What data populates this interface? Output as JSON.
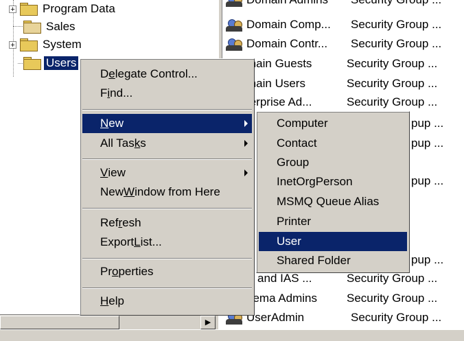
{
  "tree": {
    "items": [
      {
        "label": "Program Data",
        "expander": "+"
      },
      {
        "label": "Sales",
        "expander": ""
      },
      {
        "label": "System",
        "expander": "+"
      },
      {
        "label": "Users",
        "expander": ""
      }
    ]
  },
  "list": {
    "rows": [
      {
        "name": "Domain Admins",
        "type": "Security Group ..."
      },
      {
        "name": "Domain Comp...",
        "type": "Security Group ..."
      },
      {
        "name": "Domain Contr...",
        "type": "Security Group ..."
      },
      {
        "name": "main Guests",
        "type": "Security Group ..."
      },
      {
        "name": "main Users",
        "type": "Security Group ..."
      },
      {
        "name": "terprise Ad...",
        "type": "Security Group ..."
      },
      {
        "name": "",
        "type": "pup ..."
      },
      {
        "name": "",
        "type": "pup ..."
      },
      {
        "name": "",
        "type": ""
      },
      {
        "name": "",
        "type": "pup ..."
      },
      {
        "name": "",
        "type": ""
      },
      {
        "name": "",
        "type": ""
      },
      {
        "name": "",
        "type": ""
      },
      {
        "name": "",
        "type": "pup ..."
      },
      {
        "name": "S and IAS ...",
        "type": "Security Group ..."
      },
      {
        "name": "hema Admins",
        "type": "Security Group ..."
      },
      {
        "name": "UserAdmin",
        "type": "Security Group ..."
      }
    ]
  },
  "context_menu": {
    "items": {
      "delegate": {
        "pre": "D",
        "u": "e",
        "post": "legate Control..."
      },
      "find": {
        "pre": "F",
        "u": "i",
        "post": "nd..."
      },
      "new": {
        "pre": "",
        "u": "N",
        "post": "ew"
      },
      "all_tasks": {
        "pre": "All Tas",
        "u": "k",
        "post": "s"
      },
      "view": {
        "pre": "",
        "u": "V",
        "post": "iew"
      },
      "new_window": {
        "pre": "New ",
        "u": "W",
        "post": "indow from Here"
      },
      "refresh": {
        "pre": "Ref",
        "u": "r",
        "post": "esh"
      },
      "export": {
        "pre": "Export ",
        "u": "L",
        "post": "ist..."
      },
      "properties": {
        "pre": "Pr",
        "u": "o",
        "post": "perties"
      },
      "help": {
        "pre": "",
        "u": "H",
        "post": "elp"
      }
    }
  },
  "submenu": {
    "items": [
      "Computer",
      "Contact",
      "Group",
      "InetOrgPerson",
      "MSMQ Queue Alias",
      "Printer",
      "User",
      "Shared Folder"
    ],
    "selected": "User"
  },
  "colors": {
    "highlight": "#0a246a",
    "menu_bg": "#d4d0c8",
    "folder": "#e8c95a"
  }
}
